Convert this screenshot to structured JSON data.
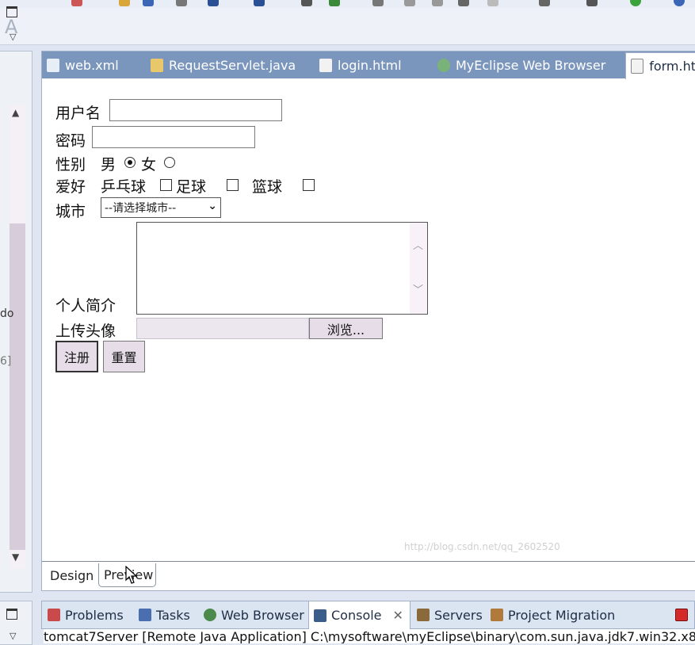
{
  "toolbar": {
    "font_glyph": "A"
  },
  "editor_tabs": [
    {
      "label": "web.xml",
      "icon": "xml-file-icon",
      "color": "#e8eef6"
    },
    {
      "label": "RequestServlet.java",
      "icon": "java-file-icon",
      "color": "#e8c86a"
    },
    {
      "label": "login.html",
      "icon": "html-file-icon",
      "color": "#f2f2f2"
    },
    {
      "label": "MyEclipse Web Browser",
      "icon": "globe-icon",
      "color": "#7ab37a"
    },
    {
      "label": "form.ht",
      "icon": "html-file-icon",
      "color": "#f2f2f2"
    }
  ],
  "left_panel": {
    "frag1": "do",
    "frag2": "6]"
  },
  "form": {
    "username_label": "用户名",
    "password_label": "密码",
    "gender_label": "性别",
    "male_label": "男",
    "female_label": "女",
    "gender_selected": "男",
    "hobby_label": "爱好",
    "hobby_pingpong": "乒乓球",
    "hobby_football": "足球",
    "hobby_basketball": "篮球",
    "city_label": "城市",
    "city_selected": "--请选择城市--",
    "intro_label": "个人简介",
    "avatar_label": "上传头像",
    "browse_label": "浏览...",
    "submit_label": "注册",
    "reset_label": "重置"
  },
  "view_tabs": {
    "design": "Design",
    "preview": "Preview",
    "active": "Preview"
  },
  "bottom_tabs": [
    {
      "label": "Problems",
      "icon": "problems-icon",
      "color": "#c84a4a"
    },
    {
      "label": "Tasks",
      "icon": "tasks-icon",
      "color": "#4a6fb0"
    },
    {
      "label": "Web Browser",
      "icon": "globe-icon",
      "color": "#4a8a4a"
    },
    {
      "label": "Console",
      "icon": "console-icon",
      "color": "#3b5d8a"
    },
    {
      "label": "Servers",
      "icon": "servers-icon",
      "color": "#8a6a3a"
    },
    {
      "label": "Project Migration",
      "icon": "migration-icon",
      "color": "#b07a3a"
    }
  ],
  "console": {
    "close_glyph": "✕",
    "line": "tomcat7Server [Remote Java Application] C:\\mysoftware\\myEclipse\\binary\\com.sun.java.jdk7.win32.x8"
  },
  "watermark": "http://blog.csdn.net/qq_2602520"
}
